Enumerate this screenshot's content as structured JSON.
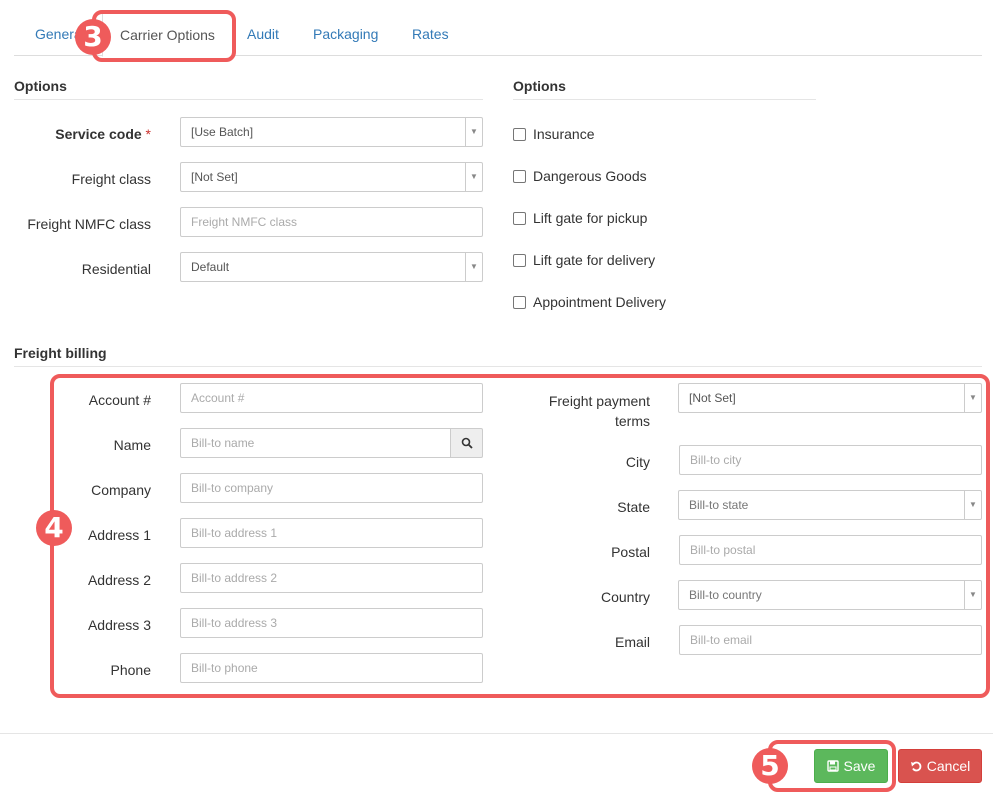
{
  "tabs": [
    {
      "label": "General"
    },
    {
      "label": "Carrier Options"
    },
    {
      "label": "Audit"
    },
    {
      "label": "Packaging"
    },
    {
      "label": "Rates"
    }
  ],
  "options_left": {
    "title": "Options",
    "service_code": {
      "label": "Service code",
      "required": "*",
      "value": "[Use Batch]"
    },
    "freight_class": {
      "label": "Freight class",
      "value": "[Not Set]"
    },
    "nmfc": {
      "label": "Freight NMFC class",
      "placeholder": "Freight NMFC class"
    },
    "residential": {
      "label": "Residential",
      "value": "Default"
    }
  },
  "options_right": {
    "title": "Options",
    "checkboxes": [
      {
        "label": "Insurance"
      },
      {
        "label": "Dangerous Goods"
      },
      {
        "label": "Lift gate for pickup"
      },
      {
        "label": "Lift gate for delivery"
      },
      {
        "label": "Appointment Delivery"
      }
    ]
  },
  "freight_billing": {
    "title": "Freight billing",
    "account": {
      "label": "Account #",
      "placeholder": "Account #"
    },
    "name": {
      "label": "Name",
      "placeholder": "Bill-to name"
    },
    "company": {
      "label": "Company",
      "placeholder": "Bill-to company"
    },
    "address1": {
      "label": "Address 1",
      "placeholder": "Bill-to address 1"
    },
    "address2": {
      "label": "Address 2",
      "placeholder": "Bill-to address 2"
    },
    "address3": {
      "label": "Address 3",
      "placeholder": "Bill-to address 3"
    },
    "phone": {
      "label": "Phone",
      "placeholder": "Bill-to phone"
    },
    "payment_terms": {
      "label_line1": "Freight payment",
      "label_line2": "terms",
      "value": "[Not Set]"
    },
    "city": {
      "label": "City",
      "placeholder": "Bill-to city"
    },
    "state": {
      "label": "State",
      "value": "Bill-to state"
    },
    "postal": {
      "label": "Postal",
      "placeholder": "Bill-to postal"
    },
    "country": {
      "label": "Country",
      "value": "Bill-to country"
    },
    "email": {
      "label": "Email",
      "placeholder": "Bill-to email"
    }
  },
  "footer": {
    "save_label": "Save",
    "cancel_label": "Cancel"
  },
  "annotations": {
    "n3": "3",
    "n4": "4",
    "n5": "5",
    "color": "#ef5b5b"
  },
  "colors": {
    "link": "#337ab7",
    "save": "#5cb85c",
    "cancel": "#d9534f"
  }
}
